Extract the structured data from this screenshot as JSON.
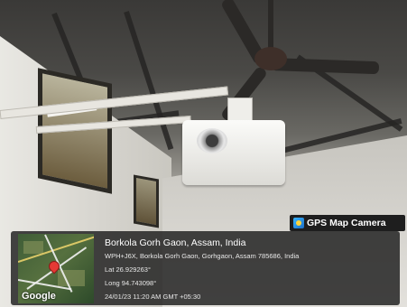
{
  "overlay": {
    "app_name": "GPS Map Camera",
    "location_title": "Borkola Gorh Gaon, Assam, India",
    "address": "WPH+J6X, Borkola Gorh Gaon, Gorhgaon, Assam 785686, India",
    "latitude": "Lat 26.929263°",
    "longitude": "Long 94.743098°",
    "datetime": "24/01/23 11:20 AM GMT +05:30",
    "map_label": "Google"
  },
  "icons": {
    "app": "gps-map-camera-icon",
    "pin": "map-pin-icon"
  },
  "colors": {
    "overlay_bg": "#1c1c1c",
    "pin": "#e53935",
    "text": "#ffffff"
  }
}
